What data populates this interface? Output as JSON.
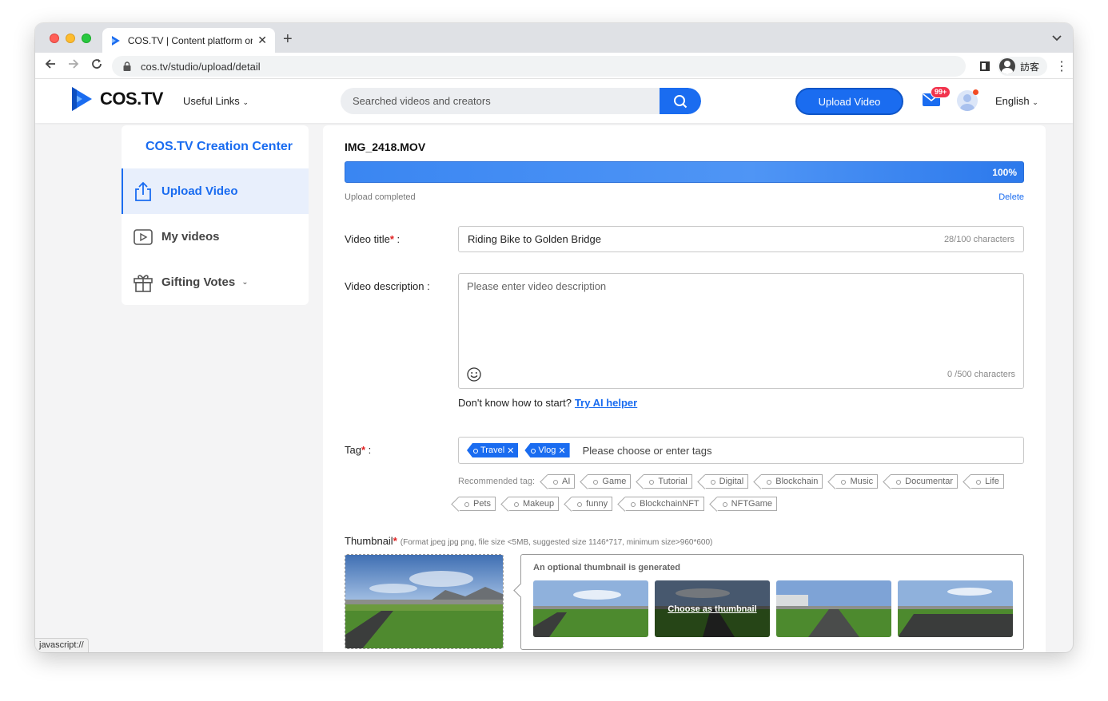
{
  "browser": {
    "tab_title": "COS.TV | Content platform on ",
    "tab_close": "✕",
    "new_tab": "+",
    "url": "cos.tv/studio/upload/detail",
    "profile_name": "訪客",
    "status_url": "javascript://"
  },
  "header": {
    "logo_text": "COS.TV",
    "useful_links": "Useful Links",
    "search_placeholder": "Searched videos and creators",
    "upload_button": "Upload Video",
    "mail_badge": "99+",
    "language": "English"
  },
  "sidebar": {
    "title": "COS.TV Creation Center",
    "items": [
      {
        "label": "Upload Video",
        "icon": "upload-icon"
      },
      {
        "label": "My videos",
        "icon": "play-icon"
      },
      {
        "label": "Gifting Votes",
        "icon": "gift-icon"
      }
    ]
  },
  "upload": {
    "file_name": "IMG_2418.MOV",
    "progress_percent": 100,
    "progress_label": "100%",
    "status": "Upload completed",
    "delete": "Delete"
  },
  "form": {
    "title_label": "Video title",
    "title_value": "Riding Bike to Golden Bridge",
    "title_counter": "28/100 characters",
    "desc_label": "Video description :",
    "desc_placeholder": "Please enter video description",
    "desc_counter": "0 /500 characters",
    "ai_prompt": "Don't know how to start?",
    "ai_link": "Try AI helper",
    "tag_label": "Tag",
    "selected_tags": [
      "Travel",
      "Vlog"
    ],
    "tag_placeholder": "Please choose or enter tags",
    "recommended_label": "Recommended tag:",
    "recommended_row1": [
      "AI",
      "Game",
      "Tutorial",
      "Digital",
      "Blockchain",
      "Music",
      "Documentar",
      "Life"
    ],
    "recommended_row2": [
      "Pets",
      "Makeup",
      "funny",
      "BlockchainNFT",
      "NFTGame"
    ],
    "thumbnail_label": "Thumbnail",
    "thumbnail_hint": "(Format jpeg jpg png, file size <5MB, suggested size 1146*717, minimum size>960*600)",
    "generated_title": "An optional thumbnail is generated",
    "choose_thumbnail": "Choose as thumbnail"
  },
  "colors": {
    "accent": "#1a6cf0",
    "required": "#e02020",
    "badge": "#f2344d"
  }
}
